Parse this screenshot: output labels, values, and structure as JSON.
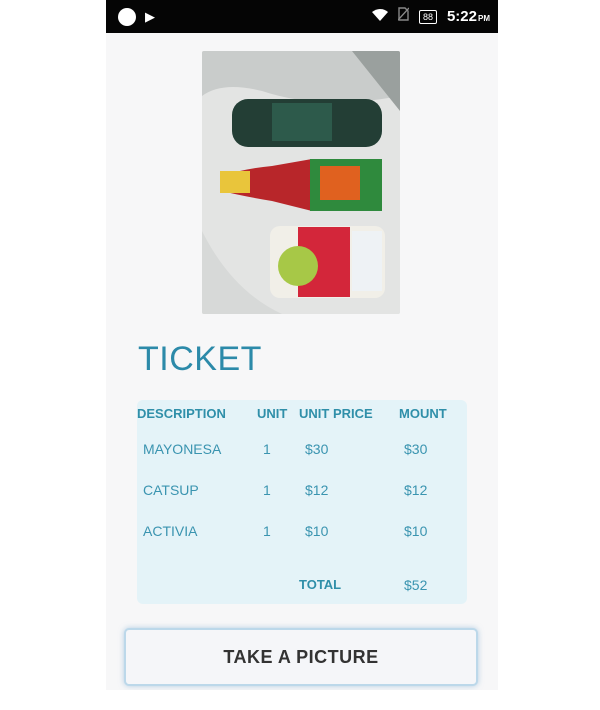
{
  "status_bar": {
    "time": "5:22",
    "ampm": "PM",
    "battery": "88",
    "icons": [
      "circle-icon",
      "play-store-icon",
      "wifi-icon",
      "no-sim-icon",
      "battery-icon"
    ]
  },
  "ticket": {
    "title": "TICKET",
    "columns": [
      "DESCRIPTION",
      "UNIT",
      "UNIT PRICE",
      "MOUNT"
    ],
    "rows": [
      {
        "description": "MAYONESA",
        "unit": "1",
        "unit_price": "$30",
        "mount": "$30"
      },
      {
        "description": "CATSUP",
        "unit": "1",
        "unit_price": "$12",
        "mount": "$12"
      },
      {
        "description": "ACTIVIA",
        "unit": "1",
        "unit_price": "$10",
        "mount": "$10"
      }
    ],
    "total_label": "TOTAL",
    "total_value": "$52"
  },
  "actions": {
    "take_picture_label": "TAKE A PICTURE"
  },
  "colors": {
    "accent": "#2c8aa9",
    "table_bg": "#e4f3f8",
    "status_bar": "#050505"
  }
}
